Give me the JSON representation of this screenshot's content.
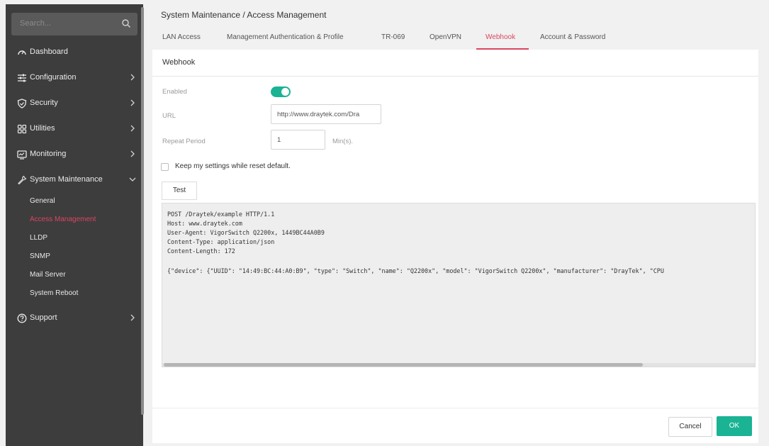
{
  "sidebar": {
    "search_placeholder": "Search...",
    "items": [
      {
        "label": "Dashboard",
        "icon": "dashboard-icon"
      },
      {
        "label": "Configuration",
        "icon": "sliders-icon"
      },
      {
        "label": "Security",
        "icon": "shield-icon"
      },
      {
        "label": "Utilities",
        "icon": "grid-icon"
      },
      {
        "label": "Monitoring",
        "icon": "monitor-icon"
      },
      {
        "label": "System Maintenance",
        "icon": "wrench-icon"
      },
      {
        "label": "Support",
        "icon": "help-icon"
      }
    ],
    "sub_items": [
      "General",
      "Access Management",
      "LLDP",
      "SNMP",
      "Mail Server",
      "System Reboot"
    ]
  },
  "header": {
    "breadcrumb": "System Maintenance /  Access Management",
    "tabs": [
      "LAN Access",
      "Management Authentication & Profile",
      "TR-069",
      "OpenVPN",
      "Webhook",
      "Account & Password"
    ],
    "active_tab": "Webhook"
  },
  "card": {
    "title": "Webhook",
    "enabled_label": "Enabled",
    "enabled": true,
    "url_label": "URL",
    "url_value": "http://www.draytek.com/Dra",
    "repeat_label": "Repeat Period",
    "repeat_value": "1",
    "repeat_unit": "Min(s).",
    "keep_settings_label": "Keep my settings while reset default.",
    "test_button": "Test",
    "code_lines": [
      "POST /Draytek/example HTTP/1.1",
      "Host: www.draytek.com",
      "User-Agent: VigorSwitch Q2200x, 1449BC44A0B9",
      "Content-Type: application/json",
      "Content-Length: 172",
      "{\"device\": {\"UUID\": \"14:49:BC:44:A0:B9\", \"type\": \"Switch\", \"name\": \"Q2200x\", \"model\": \"VigorSwitch Q2200x\", \"manufacturer\": \"DrayTek\", \"CPU"
    ],
    "cancel_button": "Cancel",
    "ok_button": "OK"
  },
  "colors": {
    "accent_red": "#d94660",
    "toggle_green": "#1ab394",
    "sidebar_bg": "#3d3d3d"
  }
}
